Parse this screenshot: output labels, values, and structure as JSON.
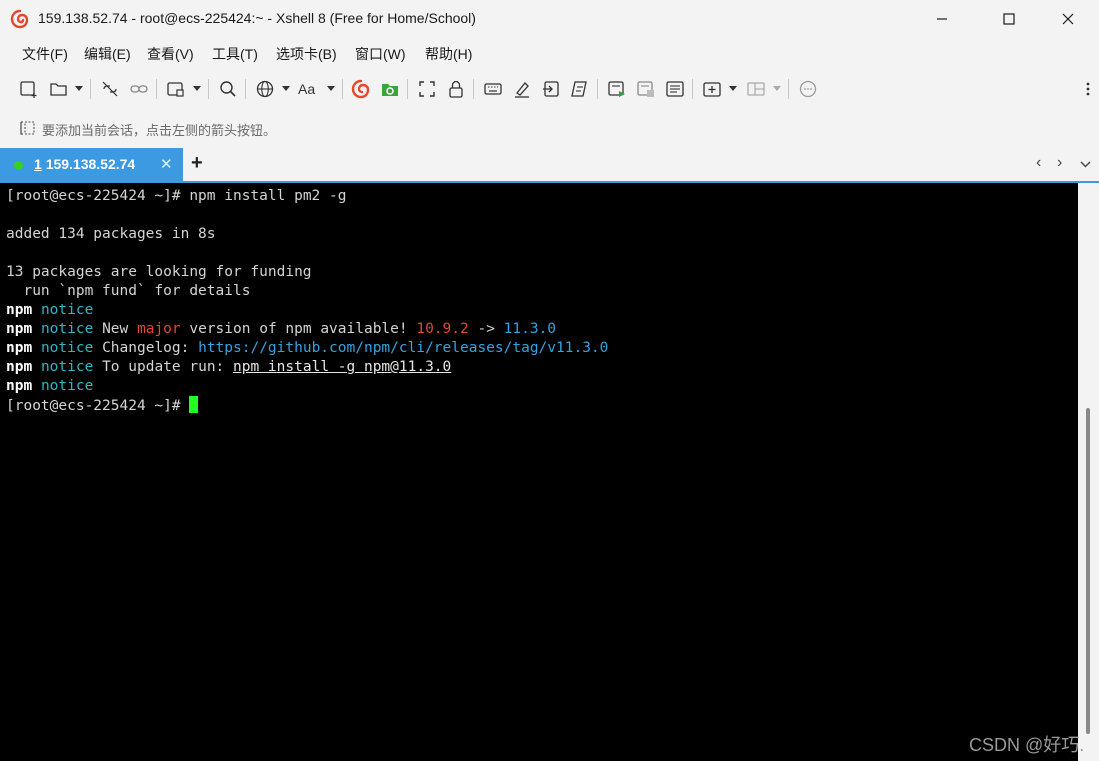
{
  "window": {
    "title": "159.138.52.74 - root@ecs-225424:~ - Xshell 8 (Free for Home/School)",
    "app_icon": "xshell-logo-icon",
    "controls": [
      "minimize-icon",
      "maximize-icon",
      "close-icon"
    ]
  },
  "menu": {
    "items": [
      "文件(F)",
      "编辑(E)",
      "查看(V)",
      "工具(T)",
      "选项卡(B)",
      "窗口(W)",
      "帮助(H)"
    ]
  },
  "toolbar": {
    "icons": [
      "new-session-icon",
      "open-folder-icon",
      "disconnect-icon",
      "connect-link-icon",
      "new-window-icon",
      "search-icon",
      "globe-icon",
      "font-icon",
      "xshell-icon",
      "xftp-icon",
      "fullscreen-icon",
      "lock-icon",
      "keyboard-icon",
      "highlight-icon",
      "transfer-icon",
      "script-icon",
      "compose-bar-icon",
      "compose-pane-icon",
      "quick-commands-icon",
      "new-tab-group-icon",
      "layout-icon",
      "chat-icon"
    ]
  },
  "address": {
    "hint": "要添加当前会话，点击左侧的箭头按钮。"
  },
  "tabs": {
    "active": {
      "number": "1",
      "label": "159.138.52.74"
    }
  },
  "terminal": {
    "prompt": "[root@ecs-225424 ~]# ",
    "command": "npm install pm2 -g",
    "added": "added 134 packages in 8s",
    "funding1": "13 packages are looking for funding",
    "funding2": "  run `npm fund` for details",
    "npm": "npm",
    "notice": "notice",
    "new_text": "New ",
    "major": "major",
    "version_text": " version of npm available! ",
    "old_version": "10.9.2",
    "arrow": " -> ",
    "new_version": "11.3.0",
    "changelog_label": "Changelog: ",
    "changelog_url": "https://github.com/npm/cli/releases/tag/v11.3.0",
    "update_label": "To update run: ",
    "update_cmd": "npm install -g npm@11.3.0",
    "final_prompt": "[root@ecs-225424 ~]# "
  },
  "watermark": "CSDN @好巧."
}
